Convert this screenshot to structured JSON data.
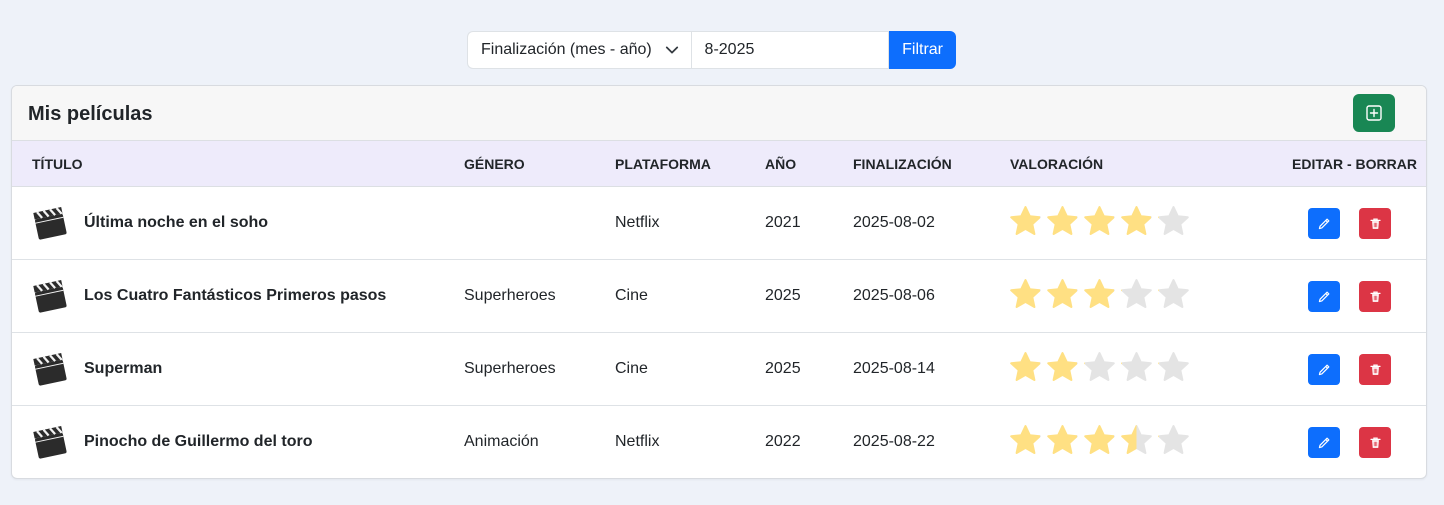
{
  "filter": {
    "select_value": "Finalización (mes - año)",
    "input_value": "8-2025",
    "button_label": "Filtrar"
  },
  "card": {
    "title": "Mis películas"
  },
  "table": {
    "headers": [
      "TÍTULO",
      "GÉNERO",
      "PLATAFORMA",
      "AÑO",
      "FINALIZACIÓN",
      "VALORACIÓN",
      "EDITAR - BORRAR"
    ],
    "rows": [
      {
        "title": "Última noche en el soho",
        "genre": "",
        "platform": "Netflix",
        "year": "2021",
        "finished": "2025-08-02",
        "rating": 4
      },
      {
        "title": "Los Cuatro Fantásticos Primeros pasos",
        "genre": "Superheroes",
        "platform": "Cine",
        "year": "2025",
        "finished": "2025-08-06",
        "rating": 3
      },
      {
        "title": "Superman",
        "genre": "Superheroes",
        "platform": "Cine",
        "year": "2025",
        "finished": "2025-08-14",
        "rating": 2
      },
      {
        "title": "Pinocho de Guillermo del toro",
        "genre": "Animación",
        "platform": "Netflix",
        "year": "2022",
        "finished": "2025-08-22",
        "rating": 3.5
      }
    ]
  },
  "colors": {
    "primary": "#0d6efd",
    "success": "#198754",
    "danger": "#dc3545",
    "star_filled": "#ffe083",
    "star_empty": "#e4e4e4"
  },
  "icons": {
    "select_chevron": "chevron-down-icon",
    "add": "plus-square-icon",
    "movie": "clapperboard-icon",
    "star": "star-icon",
    "edit": "pencil-icon",
    "delete": "trash-icon"
  }
}
